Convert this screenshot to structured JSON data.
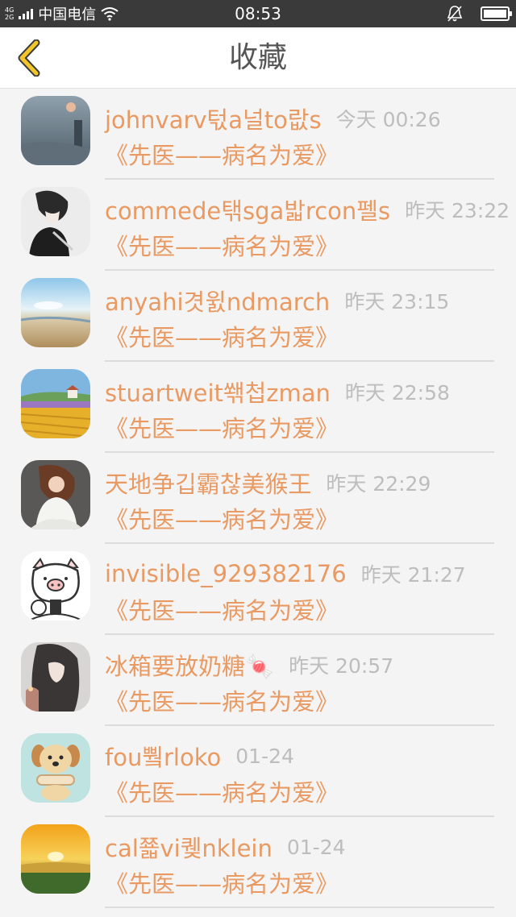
{
  "status": {
    "tech_top": "4G",
    "tech_bottom": "2G",
    "carrier": "中国电信",
    "time": "08:53"
  },
  "nav": {
    "title": "收藏",
    "back_icon": "chevron-left-icon"
  },
  "colors": {
    "accent": "#e99a63",
    "time_gray": "#bdbdbd",
    "back_yellow": "#f2c52a"
  },
  "items": [
    {
      "username": "johnvarv턳a널to랎s",
      "time": "今天 00:26",
      "title": "《先医——病名为爱》"
    },
    {
      "username": "commede탞sga밟rcon펠s",
      "time": "昨天 23:22",
      "title": "《先医——病名为爱》"
    },
    {
      "username": "anyahi겻윐ndmarch",
      "time": "昨天 23:15",
      "title": "《先医——病名为爱》"
    },
    {
      "username": "stuartweit쐒첩zman",
      "time": "昨天 22:58",
      "title": "《先医——病名为爱》"
    },
    {
      "username": "天地争깁霸찮美猴王",
      "time": "昨天 22:29",
      "title": "《先医——病名为爱》"
    },
    {
      "username": "invisible_929382176",
      "time": "昨天 21:27",
      "title": "《先医——病名为爱》"
    },
    {
      "username": "冰箱要放奶糖🍬",
      "time": "昨天 20:57",
      "title": "《先医——病名为爱》"
    },
    {
      "username": "fou쀀rloko",
      "time": "01-24",
      "title": "《先医——病名为爱》"
    },
    {
      "username": "cal쬷vi퀮nklein",
      "time": "01-24",
      "title": "《先医——病名为爱》"
    }
  ]
}
